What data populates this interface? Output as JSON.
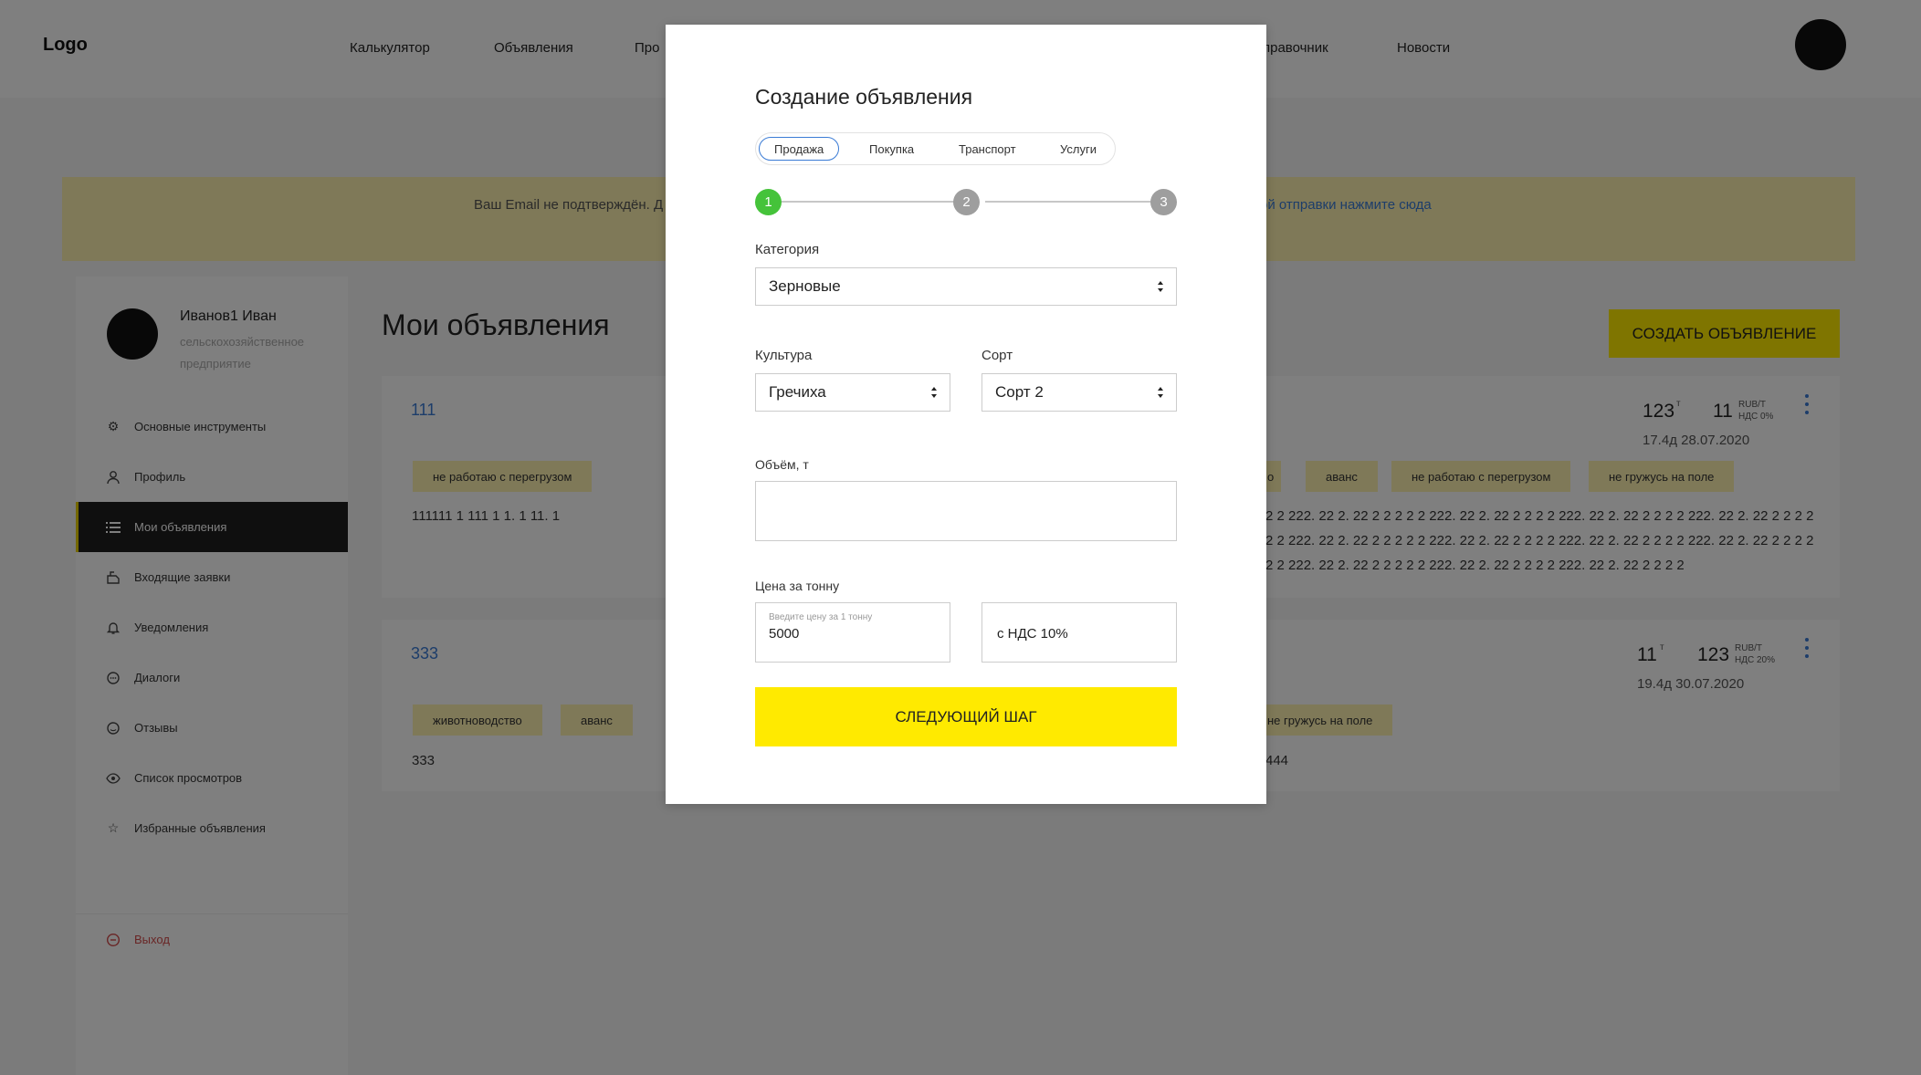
{
  "header": {
    "logo": "Logo",
    "nav": [
      "Калькулятор",
      "Объявления",
      "Про",
      "правочник",
      "Новости"
    ]
  },
  "banner": {
    "text": "Ваш Email не подтверждён. Д",
    "link": "ой отправки нажмите сюда"
  },
  "sidebar": {
    "user_name": "Иванов1 Иван",
    "user_role": "сельскохозяйственное предприятие",
    "items": [
      {
        "label": "Основные инструменты",
        "icon": "gear-icon"
      },
      {
        "label": "Профиль",
        "icon": "user-icon"
      },
      {
        "label": "Мои объявления",
        "icon": "list-icon",
        "active": true
      },
      {
        "label": "Входящие заявки",
        "icon": "inbox-icon"
      },
      {
        "label": "Уведомления",
        "icon": "bell-icon"
      },
      {
        "label": "Диалоги",
        "icon": "chat-icon"
      },
      {
        "label": "Отзывы",
        "icon": "review-icon"
      },
      {
        "label": "Список просмотров",
        "icon": "eye-icon"
      },
      {
        "label": "Избранные объявления",
        "icon": "star-icon"
      }
    ],
    "exit_label": "Выход"
  },
  "main": {
    "title": "Мои объявления",
    "create_label": "Создать объявление",
    "cards": [
      {
        "id": "111",
        "tags_left": [
          "не работаю с перегрузом"
        ],
        "tags_right": [
          "о",
          "аванс",
          "не работаю с перегрузом",
          "не гружусь на поле"
        ],
        "desc_left": "111111 1 111 1 1. 1 11. 1",
        "desc_right": [
          "2 2 222. 22 2. 22 2 2 2 2 2 222. 22 2. 22 2 2 2 2 222. 22 2. 22 2 2 2 2 222. 22 2. 22 2 2 2 2",
          "2 2 222. 22 2. 22 2 2 2 2 2 222. 22 2. 22 2 2 2 2 222. 22 2. 22 2 2 2 2 222. 22 2. 22 2 2 2 2",
          "2 2 222. 22 2. 22 2 2 2 2 2 222. 22 2. 22 2 2 2 2 222. 22 2. 22 2 2 2 2"
        ],
        "volume": "123",
        "volume_unit": "т",
        "price": "11",
        "price_unit": "RUB/Т",
        "vat": "НДС 0%",
        "date": "17.4д 28.07.2020"
      },
      {
        "id": "333",
        "tags_left": [
          "животноводство",
          "аванс"
        ],
        "tags_right": [
          "не гружусь на поле"
        ],
        "desc_left": "333",
        "desc_right": [
          "444"
        ],
        "volume": "11",
        "volume_unit": "т",
        "price": "123",
        "price_unit": "RUB/Т",
        "vat": "НДС 20%",
        "date": "19.4д 30.07.2020"
      }
    ]
  },
  "modal": {
    "title": "Создание объявления",
    "tabs": [
      "Продажа",
      "Покупка",
      "Транспорт",
      "Услуги"
    ],
    "active_tab": 0,
    "steps": [
      "1",
      "2",
      "3"
    ],
    "category_label": "Категория",
    "category_value": "Зерновые",
    "culture_label": "Культура",
    "culture_value": "Гречиха",
    "sort_label": "Сорт",
    "sort_value": "Сорт 2",
    "volume_label": "Объём, т",
    "volume_value": "",
    "price_label": "Цена за тонну",
    "price_placeholder": "Введите цену за 1 тонну",
    "price_value": "5000",
    "vat_value": "с НДС 10%",
    "next_label": "Следующий шаг"
  },
  "colors": {
    "accent_yellow": "#ffea00",
    "banner_yellow": "#fff3b0",
    "link_blue": "#3a7bd5",
    "step_active": "#45c33a",
    "step_idle": "#9e9e9e",
    "exit_red": "#d24b4b"
  }
}
